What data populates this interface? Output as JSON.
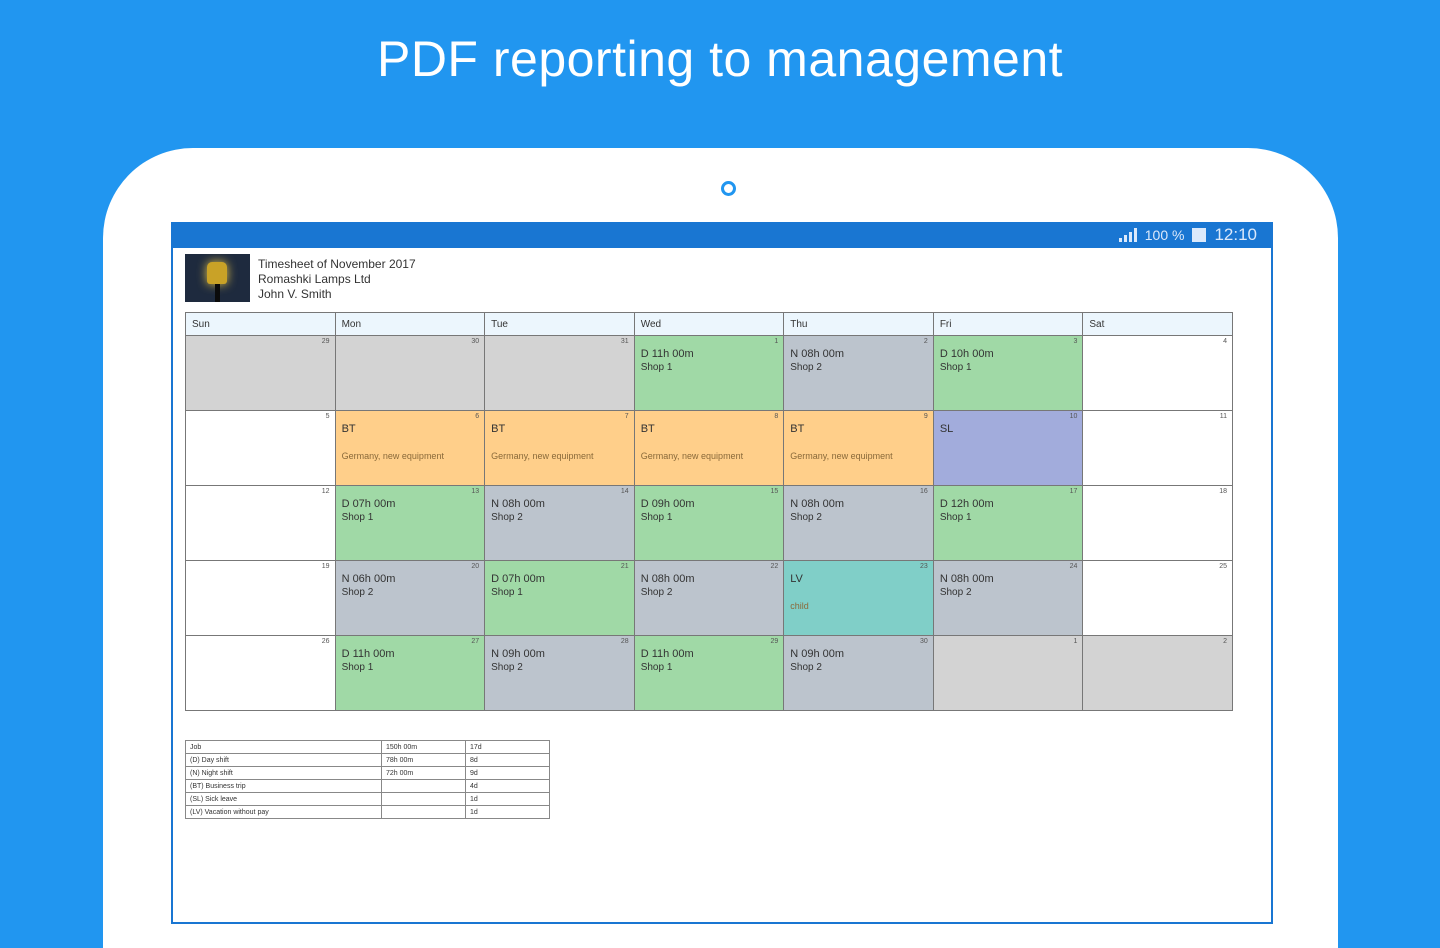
{
  "headline": "PDF reporting to management",
  "status_bar": {
    "battery_text": "100 %",
    "time": "12:10"
  },
  "report": {
    "title": "Timesheet of November 2017",
    "company": "Romashki Lamps Ltd",
    "employee": "John V. Smith"
  },
  "calendar": {
    "days": [
      "Sun",
      "Mon",
      "Tue",
      "Wed",
      "Thu",
      "Fri",
      "Sat"
    ],
    "weeks": [
      [
        {
          "day": "29",
          "kind": "empty",
          "code": "",
          "place": "",
          "note": ""
        },
        {
          "day": "30",
          "kind": "empty",
          "code": "",
          "place": "",
          "note": ""
        },
        {
          "day": "31",
          "kind": "empty",
          "code": "",
          "place": "",
          "note": ""
        },
        {
          "day": "1",
          "kind": "D",
          "code": "D 11h 00m",
          "place": "Shop 1",
          "note": ""
        },
        {
          "day": "2",
          "kind": "N",
          "code": "N 08h 00m",
          "place": "Shop 2",
          "note": ""
        },
        {
          "day": "3",
          "kind": "D",
          "code": "D 10h 00m",
          "place": "Shop 1",
          "note": ""
        },
        {
          "day": "4",
          "kind": "blank",
          "code": "",
          "place": "",
          "note": ""
        }
      ],
      [
        {
          "day": "5",
          "kind": "blank",
          "code": "",
          "place": "",
          "note": ""
        },
        {
          "day": "6",
          "kind": "BT",
          "code": "BT",
          "place": "",
          "note": "Germany, new equipment"
        },
        {
          "day": "7",
          "kind": "BT",
          "code": "BT",
          "place": "",
          "note": "Germany, new equipment"
        },
        {
          "day": "8",
          "kind": "BT",
          "code": "BT",
          "place": "",
          "note": "Germany, new equipment"
        },
        {
          "day": "9",
          "kind": "BT",
          "code": "BT",
          "place": "",
          "note": "Germany, new equipment"
        },
        {
          "day": "10",
          "kind": "SL",
          "code": "SL",
          "place": "",
          "note": ""
        },
        {
          "day": "11",
          "kind": "blank",
          "code": "",
          "place": "",
          "note": ""
        }
      ],
      [
        {
          "day": "12",
          "kind": "blank",
          "code": "",
          "place": "",
          "note": ""
        },
        {
          "day": "13",
          "kind": "D",
          "code": "D 07h 00m",
          "place": "Shop 1",
          "note": ""
        },
        {
          "day": "14",
          "kind": "N",
          "code": "N 08h 00m",
          "place": "Shop 2",
          "note": ""
        },
        {
          "day": "15",
          "kind": "D",
          "code": "D 09h 00m",
          "place": "Shop 1",
          "note": ""
        },
        {
          "day": "16",
          "kind": "N",
          "code": "N 08h 00m",
          "place": "Shop 2",
          "note": ""
        },
        {
          "day": "17",
          "kind": "D",
          "code": "D 12h 00m",
          "place": "Shop 1",
          "note": ""
        },
        {
          "day": "18",
          "kind": "blank",
          "code": "",
          "place": "",
          "note": ""
        }
      ],
      [
        {
          "day": "19",
          "kind": "blank",
          "code": "",
          "place": "",
          "note": ""
        },
        {
          "day": "20",
          "kind": "N",
          "code": "N 06h 00m",
          "place": "Shop 2",
          "note": ""
        },
        {
          "day": "21",
          "kind": "D",
          "code": "D 07h 00m",
          "place": "Shop 1",
          "note": ""
        },
        {
          "day": "22",
          "kind": "N",
          "code": "N 08h 00m",
          "place": "Shop 2",
          "note": ""
        },
        {
          "day": "23",
          "kind": "LV",
          "code": "LV",
          "place": "",
          "note": "child"
        },
        {
          "day": "24",
          "kind": "N",
          "code": "N 08h 00m",
          "place": "Shop 2",
          "note": ""
        },
        {
          "day": "25",
          "kind": "blank",
          "code": "",
          "place": "",
          "note": ""
        }
      ],
      [
        {
          "day": "26",
          "kind": "blank",
          "code": "",
          "place": "",
          "note": ""
        },
        {
          "day": "27",
          "kind": "D",
          "code": "D 11h 00m",
          "place": "Shop 1",
          "note": ""
        },
        {
          "day": "28",
          "kind": "N",
          "code": "N 09h 00m",
          "place": "Shop 2",
          "note": ""
        },
        {
          "day": "29",
          "kind": "D",
          "code": "D 11h 00m",
          "place": "Shop 1",
          "note": ""
        },
        {
          "day": "30",
          "kind": "N",
          "code": "N 09h 00m",
          "place": "Shop 2",
          "note": ""
        },
        {
          "day": "1",
          "kind": "empty",
          "code": "",
          "place": "",
          "note": ""
        },
        {
          "day": "2",
          "kind": "empty",
          "code": "",
          "place": "",
          "note": ""
        }
      ]
    ]
  },
  "summary": {
    "rows": [
      [
        "Job",
        "150h 00m",
        "17d"
      ],
      [
        "(D) Day shift",
        "78h 00m",
        "8d"
      ],
      [
        "(N) Night shift",
        "72h 00m",
        "9d"
      ],
      [
        "(BT) Business trip",
        "",
        "4d"
      ],
      [
        "(SL) Sick leave",
        "",
        "1d"
      ],
      [
        "(LV) Vacation without pay",
        "",
        "1d"
      ]
    ]
  },
  "colors": {
    "background": "#2196f0",
    "day_shift": "#a0d9a6",
    "night_shift": "#bcc4cd",
    "business_trip": "#ffcf8a",
    "sick_leave": "#a2acdc",
    "vacation": "#80cfc8",
    "out_of_month": "#d3d3d3"
  }
}
